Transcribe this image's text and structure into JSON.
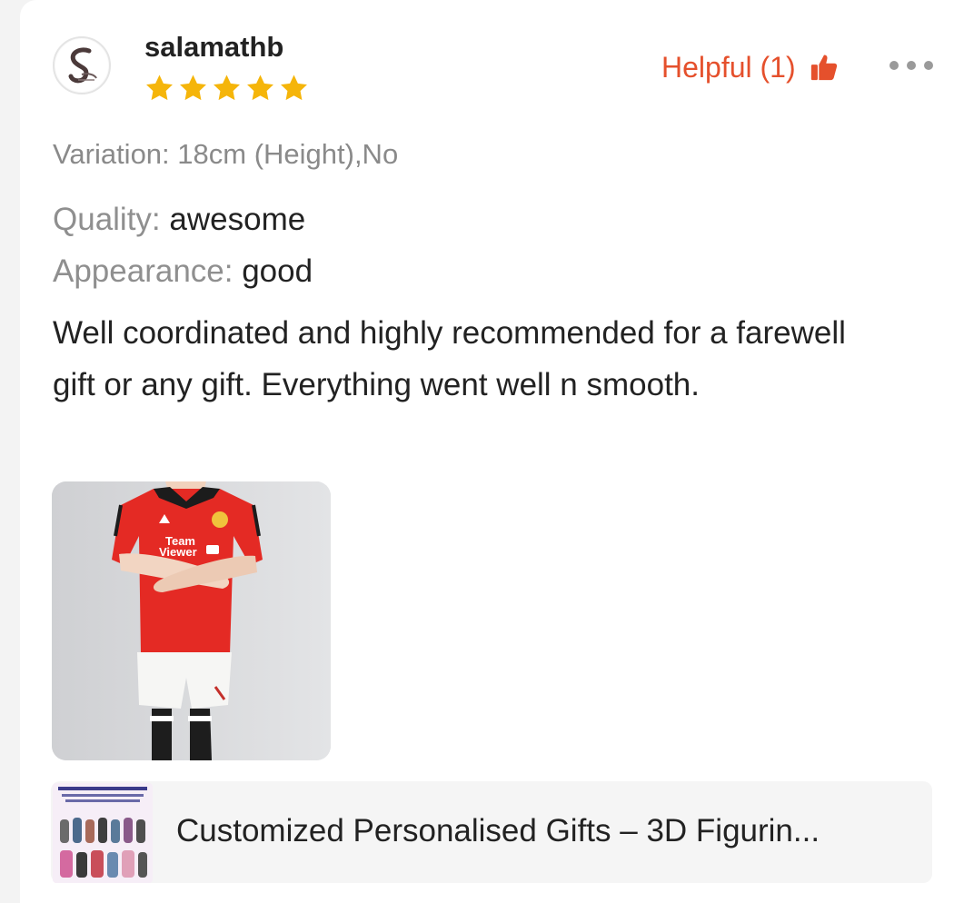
{
  "review": {
    "username": "salamathb",
    "avatar_icon": "user-avatar-logo",
    "rating": 5,
    "rating_max": 5,
    "star_color": "#f5b50a",
    "helpful_label": "Helpful (1)",
    "helpful_icon": "thumbs-up-icon",
    "helpful_color": "#e5502c",
    "more_icon": "more-options-icon",
    "variation": "Variation: 18cm (Height),No",
    "attributes": [
      {
        "key": "Quality:",
        "value": "awesome"
      },
      {
        "key": "Appearance:",
        "value": "good"
      }
    ],
    "text": "Well coordinated and highly recommended for a farewell gift or any gift. Everything went well n smooth.",
    "photo": {
      "name": "review-photo",
      "jersey_text": "Team Viewer"
    }
  },
  "product": {
    "title": "Customized Personalised Gifts – 3D Figurin..."
  }
}
